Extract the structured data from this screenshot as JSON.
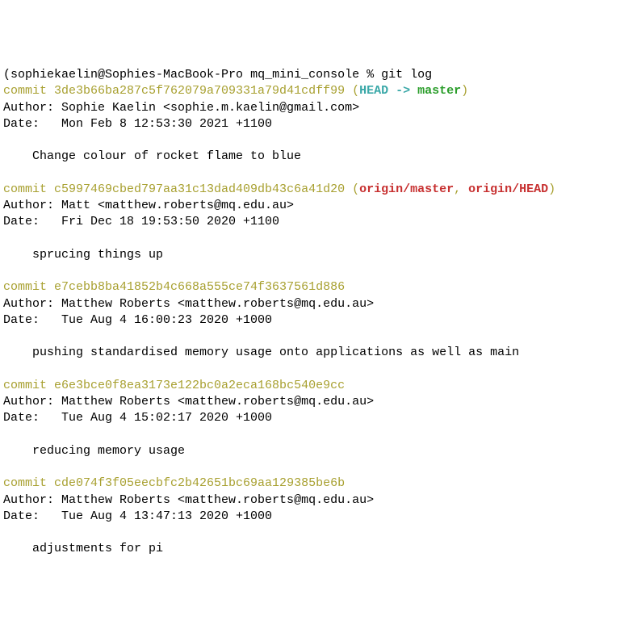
{
  "prompt": {
    "user_host": "sophiekaelin@Sophies-MacBook-Pro",
    "cwd": "mq_mini_console",
    "symbol": "%",
    "command": "git log"
  },
  "commits": [
    {
      "hash": "3de3b66ba287c5f762079a709331a79d41cdff99",
      "refs_type": "local",
      "refs_head": "HEAD -> ",
      "refs_branch": "master",
      "author": "Sophie Kaelin <sophie.m.kaelin@gmail.com>",
      "date": "Mon Feb 8 12:53:30 2021 +1100",
      "message": "Change colour of rocket flame to blue"
    },
    {
      "hash": "c5997469cbed797aa31c13dad409db43c6a41d20",
      "refs_type": "remote",
      "refs_remote1": "origin/master",
      "refs_sep": ", ",
      "refs_remote2": "origin/HEAD",
      "author": "Matt <matthew.roberts@mq.edu.au>",
      "date": "Fri Dec 18 19:53:50 2020 +1100",
      "message": "sprucing things up"
    },
    {
      "hash": "e7cebb8ba41852b4c668a555ce74f3637561d886",
      "refs_type": "none",
      "author": "Matthew Roberts <matthew.roberts@mq.edu.au>",
      "date": "Tue Aug 4 16:00:23 2020 +1000",
      "message": "pushing standardised memory usage onto applications as well as main"
    },
    {
      "hash": "e6e3bce0f8ea3173e122bc0a2eca168bc540e9cc",
      "refs_type": "none",
      "author": "Matthew Roberts <matthew.roberts@mq.edu.au>",
      "date": "Tue Aug 4 15:02:17 2020 +1000",
      "message": "reducing memory usage"
    },
    {
      "hash": "cde074f3f05eecbfc2b42651bc69aa129385be6b",
      "refs_type": "none",
      "author": "Matthew Roberts <matthew.roberts@mq.edu.au>",
      "date": "Tue Aug 4 13:47:13 2020 +1000",
      "message": "adjustments for pi"
    }
  ],
  "labels": {
    "commit_prefix": "commit ",
    "author_prefix": "Author: ",
    "date_prefix": "Date:   ",
    "message_indent": "    "
  }
}
